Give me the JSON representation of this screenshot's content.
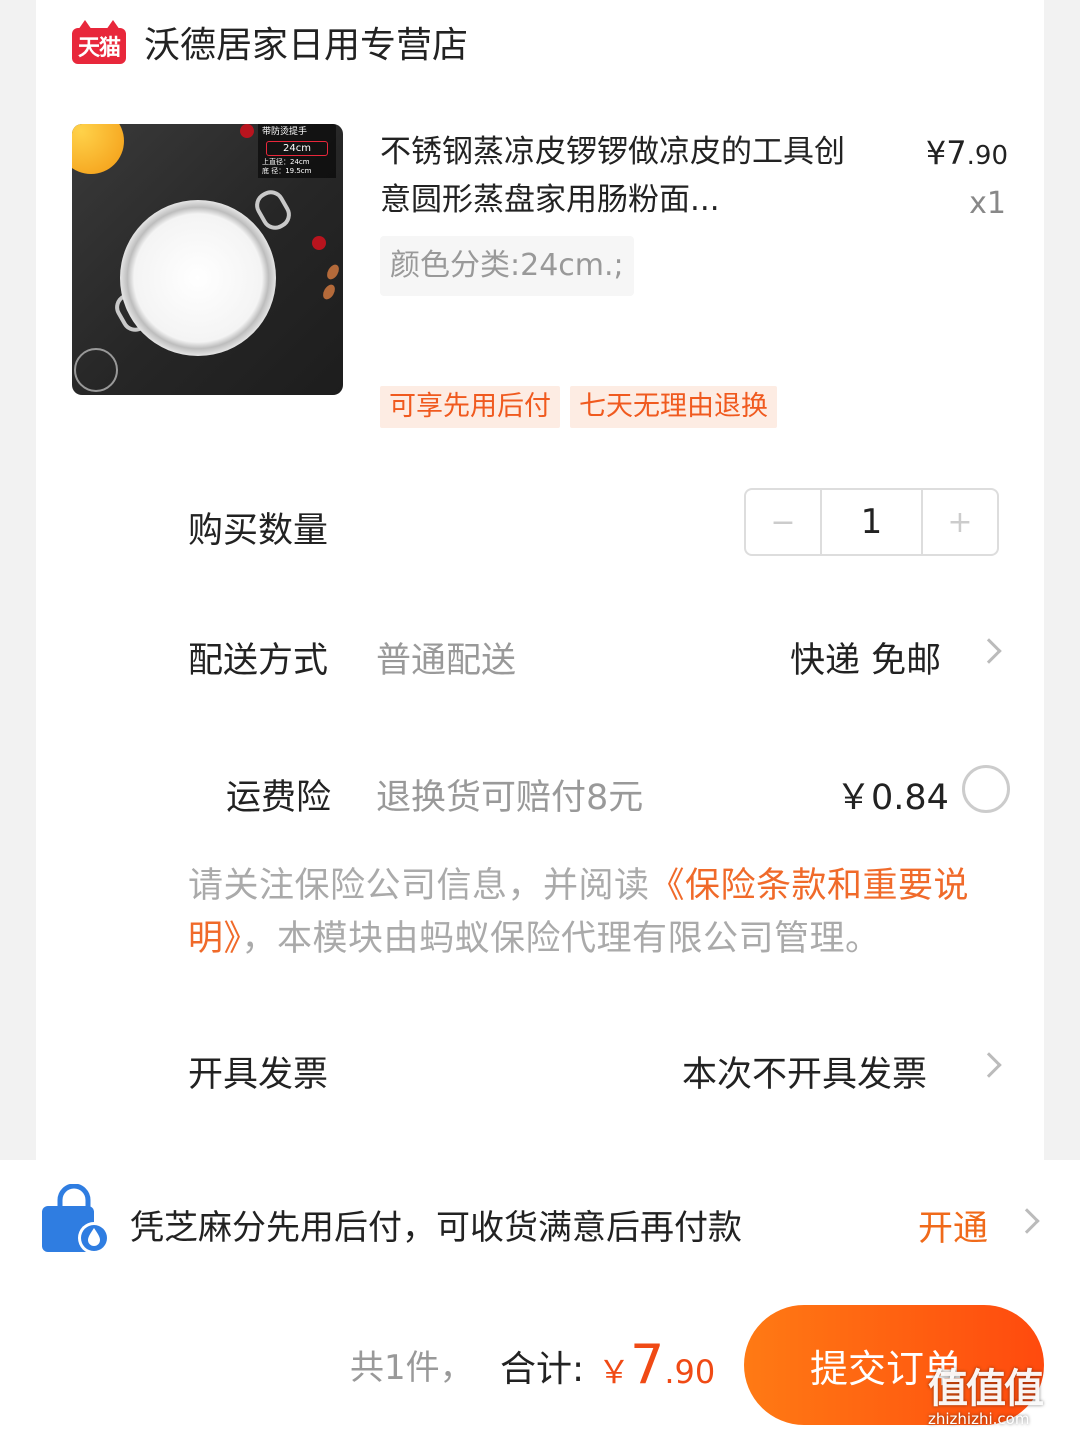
{
  "shop": {
    "badge": "天猫",
    "name": "沃德居家日用专营店"
  },
  "product": {
    "title": "不锈钢蒸凉皮锣锣做凉皮的工具创意圆形蒸盘家用肠粉面...",
    "price_symbol": "¥",
    "price_int": "7",
    "price_dec": ".90",
    "qty": "x1",
    "sku": "颜色分类:24cm.;",
    "tags": [
      "可享先用后付",
      "七天无理由退换"
    ],
    "image_overlay": {
      "title": "带防烫提手",
      "size": "24cm",
      "spec1": "上直径：24cm",
      "spec2": "底 径：19.5cm"
    }
  },
  "quantity": {
    "label": "购买数量",
    "value": "1",
    "minus": "−",
    "plus": "+"
  },
  "delivery": {
    "label": "配送方式",
    "type": "普通配送",
    "value": "快递 免邮"
  },
  "insurance": {
    "label": "运费险",
    "desc": "退换货可赔付8元",
    "price": "￥0.84",
    "checked": false
  },
  "notice": {
    "prefix": "请关注保险公司信息，并阅读",
    "link": "《保险条款和重要说明》",
    "suffix": "，本模块由蚂蚁保险代理有限公司管理。"
  },
  "invoice": {
    "label": "开具发票",
    "value": "本次不开具发票"
  },
  "paylater": {
    "text": "凭芝麻分先用后付，可收货满意后再付款",
    "action": "开通"
  },
  "footer": {
    "count": "共1件，",
    "total_label": "合计:",
    "total_symbol": "￥",
    "total_int": "7",
    "total_dec": ".90",
    "submit": "提交订单"
  },
  "watermark": {
    "logo": "值值值",
    "url": "zhizhizhi.com"
  },
  "colors": {
    "accent": "#f04a15",
    "brand_red": "#e8273b",
    "link": "#f06a2a",
    "icon_blue": "#2f7de1"
  }
}
